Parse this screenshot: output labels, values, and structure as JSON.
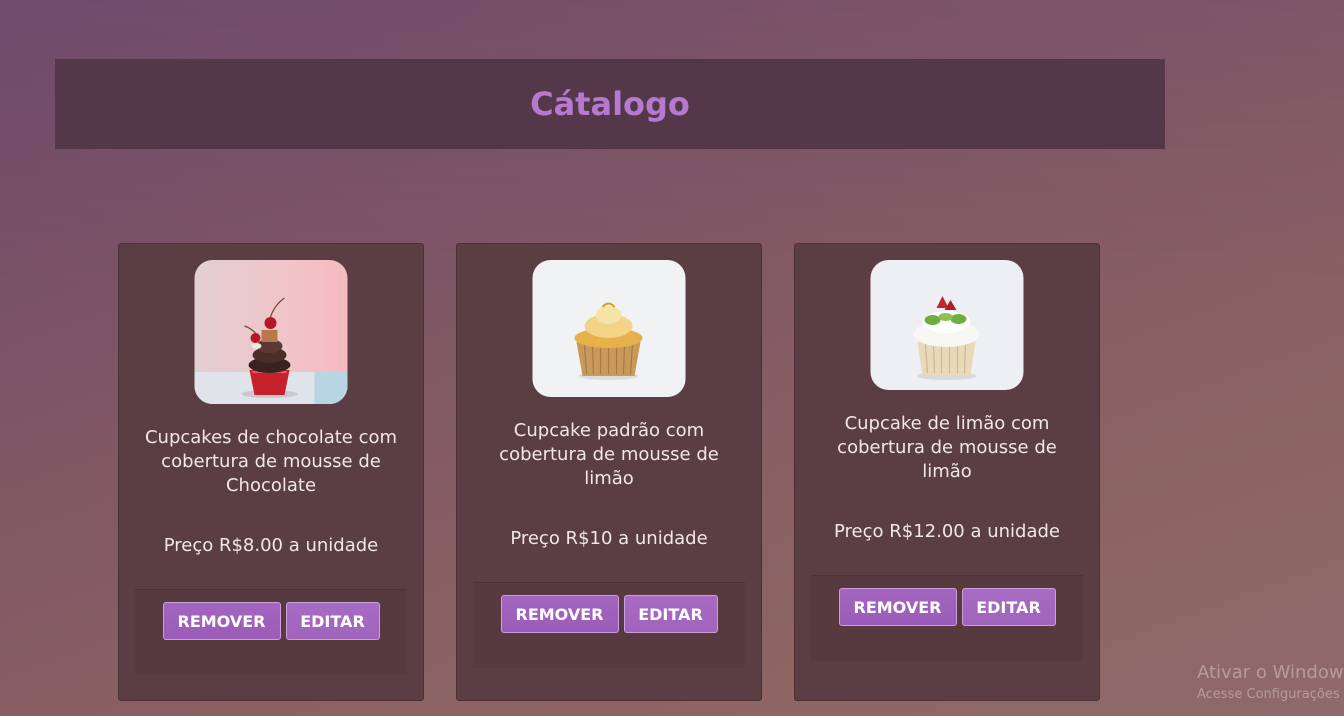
{
  "header": {
    "title": "Cátalogo"
  },
  "products": [
    {
      "name": "Cupcakes de chocolate com cobertura de mousse de Chocolate",
      "price": "Preço R$8.00 a unidade",
      "remove_label": "REMOVER",
      "edit_label": "EDITAR"
    },
    {
      "name": "Cupcake padrão com cobertura de mousse de limão",
      "price": "Preço R$10 a unidade",
      "remove_label": "REMOVER",
      "edit_label": "EDITAR"
    },
    {
      "name": "Cupcake de limão com cobertura de mousse de limão",
      "price": "Preço R$12.00 a unidade",
      "remove_label": "REMOVER",
      "edit_label": "EDITAR"
    }
  ],
  "watermark": {
    "line1": "Ativar o Windows",
    "line2": "Acesse Configurações para ativar o Windows."
  },
  "colors": {
    "title": "#b57ad0",
    "button": "#9b5cb9",
    "card": "#5b3e44"
  }
}
